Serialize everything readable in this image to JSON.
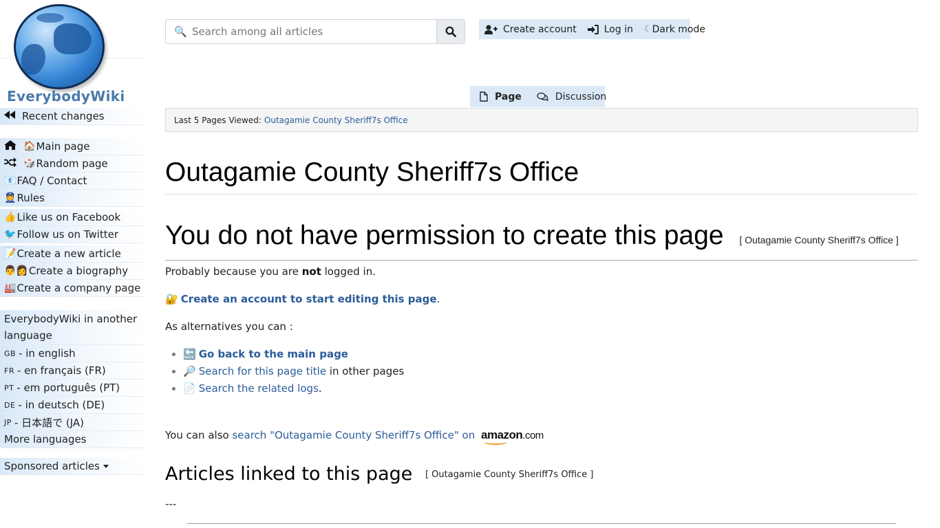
{
  "brand": {
    "name": "EverybodyWiki",
    "logo_icon": "globe-icon"
  },
  "sidebar": {
    "recent": {
      "icon": "backward-icon",
      "label": "Recent changes"
    },
    "nav_items": [
      {
        "icon": "home-icon",
        "emoji": "🏠",
        "label": "Main page"
      },
      {
        "icon": "shuffle-icon",
        "emoji": "🎲",
        "label": "Random page"
      },
      {
        "icon": "",
        "emoji": "📧",
        "label": "FAQ / Contact"
      },
      {
        "icon": "",
        "emoji": "👮",
        "label": "Rules"
      },
      {
        "icon": "",
        "emoji": "👍",
        "label": "Like us on Facebook"
      },
      {
        "icon": "",
        "emoji": "🐦",
        "label": "Follow us on Twitter"
      },
      {
        "icon": "",
        "emoji": "📝",
        "label": "Create a new article"
      },
      {
        "icon": "",
        "emoji": "👨👩",
        "label": "Create a biography"
      },
      {
        "icon": "",
        "emoji": "🏭",
        "label": "Create a company page"
      }
    ],
    "languages_header": "EverybodyWiki in another language",
    "languages": [
      {
        "code": "GB",
        "label": "- in english"
      },
      {
        "code": "FR",
        "label": "- en français (FR)"
      },
      {
        "code": "PT",
        "label": "- em português (PT)"
      },
      {
        "code": "DE",
        "label": "- in deutsch (DE)"
      },
      {
        "code": "JP",
        "label": "- 日本語で (JA)"
      }
    ],
    "more_languages": "More languages",
    "sponsored": "Sponsored articles"
  },
  "search": {
    "placeholder": "Search among all articles",
    "value": ""
  },
  "user_bar": {
    "create_account": "Create account",
    "log_in": "Log in",
    "dark_mode_icon": "☾",
    "dark_mode": "Dark mode"
  },
  "tabs": [
    {
      "label": "Page",
      "active": true
    },
    {
      "label": "Discussion",
      "active": false
    }
  ],
  "breadcrumb": {
    "label": "Last 5 Pages Viewed:",
    "pages": [
      "Outagamie County Sheriff7s Office"
    ]
  },
  "content": {
    "title": "Outagamie County Sheriff7s Office",
    "permission_heading": "You do not have permission to create this page",
    "permission_bracket": "[ Outagamie County Sheriff7s Office ]",
    "reason_pre": "Probably because you are ",
    "reason_bold": "not",
    "reason_post": " logged in.",
    "create_account_link": "Create an account to start editing this page",
    "alternatives_intro": "As alternatives you can :",
    "alternatives": [
      {
        "emoji": "🔙",
        "link": "Go back to the main page",
        "bold": true,
        "suffix": ""
      },
      {
        "emoji": "🔎",
        "link": "Search for this page title",
        "bold": false,
        "suffix": " in other pages"
      },
      {
        "emoji": "📄",
        "link": "Search the related logs",
        "bold": false,
        "suffix": "."
      }
    ],
    "amazon_pre": "You can also ",
    "amazon_link": "search \"Outagamie County Sheriff7s Office\" on",
    "amazon_brand": "amazon",
    "amazon_tld": ".com",
    "linked_heading": "Articles linked to this page",
    "linked_bracket": "[ Outagamie County Sheriff7s Office ]",
    "linked_placeholder": "---"
  }
}
